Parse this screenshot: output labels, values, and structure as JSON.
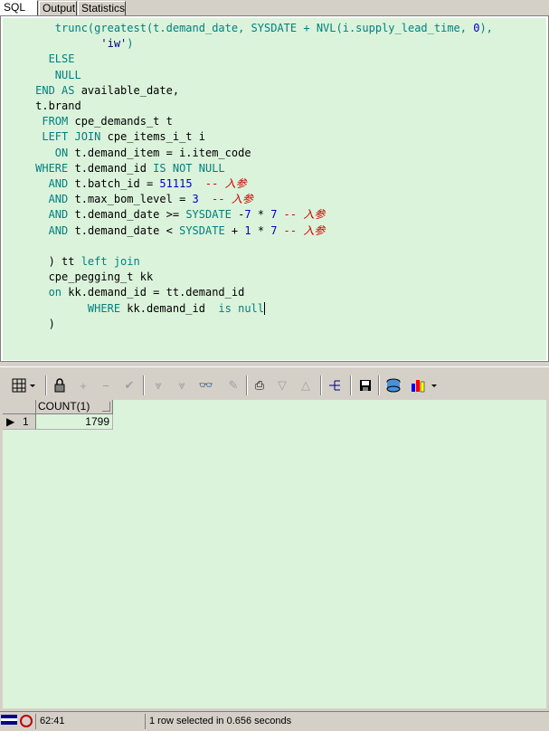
{
  "tabs": [
    "SQL",
    "Output",
    "Statistics"
  ],
  "code": {
    "l1_fn1": "trunc(",
    "l1_fn2": "greatest",
    "l1_mid": "(t.demand_date, ",
    "l1_kw": "SYSDATE",
    "l1_plus": " + ",
    "l1_fn3": "NVL",
    "l1_args": "(i.supply_lead_time, ",
    "l1_num": "0",
    "l1_end": "),",
    "l2_str": "'iw'",
    "l2_end": ")",
    "l3": "ELSE",
    "l4": "NULL",
    "l5_kw1": "END AS",
    "l5_rest": " available_date,",
    "l6": "t.brand",
    "l7_kw": "FROM",
    "l7_rest": " cpe_demands_t t",
    "l8_kw": "LEFT JOIN",
    "l8_rest": " cpe_items_i_t i",
    "l9_kw": "ON",
    "l9_rest": " t.demand_item = i.item_code",
    "l10_kw1": "WHERE",
    "l10_mid": " t.demand_id ",
    "l10_kw2": "IS NOT NULL",
    "l11_kw": "AND",
    "l11_rest": " t.batch_id = ",
    "l11_num": "51115",
    "l11_cm": "  -- 入参",
    "l12_kw": "AND",
    "l12_rest": " t.max_bom_level = ",
    "l12_num": "3",
    "l12_cm": "  -- 入参",
    "l13_kw": "AND",
    "l13_rest": " t.demand_date >= ",
    "l13_kw2": "SYSDATE",
    "l13_op": " -",
    "l13_n1": "7",
    "l13_m": " * ",
    "l13_n2": "7",
    "l13_cm": " -- 入参",
    "l14_kw": "AND",
    "l14_rest": " t.demand_date < ",
    "l14_kw2": "SYSDATE",
    "l14_op": " + ",
    "l14_n1": "1",
    "l14_m": " * ",
    "l14_n2": "7",
    "l14_cm": " -- 入参",
    "l16_a": ") tt ",
    "l16_kw": "left join",
    "l17": "cpe_pegging_t kk",
    "l18_kw": "on",
    "l18_rest": " kk.demand_id = tt.demand_id",
    "l19_kw1": "WHERE",
    "l19_mid": " kk.demand_id  ",
    "l19_kw2": "is null",
    "l20": ")"
  },
  "grid": {
    "column": "COUNT(1)",
    "row_num": "1",
    "value": "1799"
  },
  "status": {
    "position": "62:41",
    "message": "1 row selected in 0.656 seconds"
  }
}
